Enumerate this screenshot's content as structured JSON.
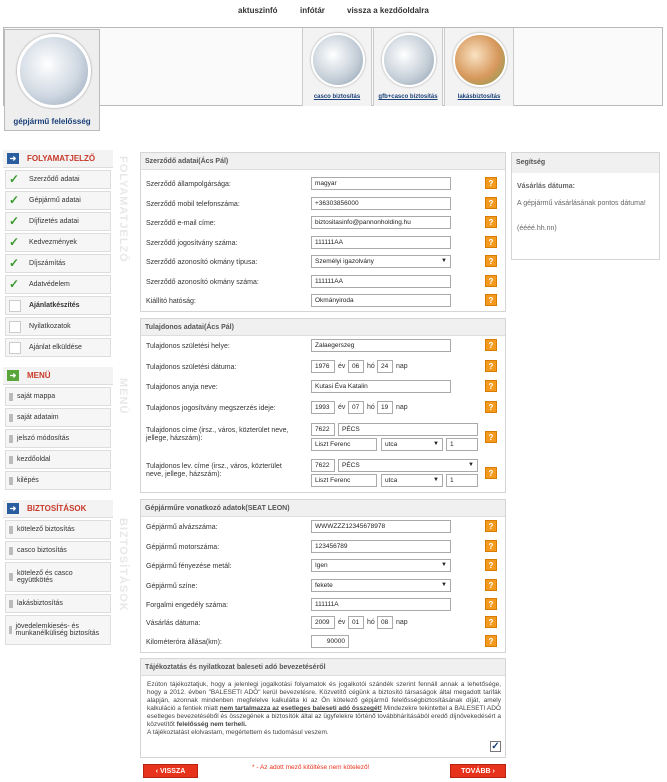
{
  "topnav": [
    "aktuszinfó",
    "infótár",
    "vissza a kezdőoldalra"
  ],
  "brand": "gépjármű felelősség",
  "promos": [
    "casco biztosítás",
    "gfb+casco biztosítás",
    "lakásbiztosítás"
  ],
  "sidebar": {
    "process_title": "FOLYAMATJELZŐ",
    "process": [
      {
        "label": "Szerződő adatai",
        "done": true
      },
      {
        "label": "Gépjármű adatai",
        "done": true
      },
      {
        "label": "Díjfizetés adatai",
        "done": true
      },
      {
        "label": "Kedvezmények",
        "done": true
      },
      {
        "label": "Díjszámítás",
        "done": true
      },
      {
        "label": "Adatvédelem",
        "done": true
      },
      {
        "label": "Ajánlatkészítés",
        "done": false
      },
      {
        "label": "Nyilatkozatok",
        "done": false
      },
      {
        "label": "Ajánlat elküldése",
        "done": false
      }
    ],
    "menu_title": "MENÜ",
    "menu": [
      "saját mappa",
      "saját adataim",
      "jelszó módosítás",
      "kezdőoldal",
      "kilépés"
    ],
    "ins_title": "BIZTOSÍTÁSOK",
    "ins": [
      "kötelező biztosítás",
      "casco biztosítás",
      "kötelező és casco együttkötés",
      "lakásbiztosítás",
      "jövedelemkiesés- és munkanélküliség biztosítás"
    ],
    "vert": [
      "FOLYAMATJELZŐ",
      "MENÜ",
      "BIZTOSÍTÁSOK"
    ]
  },
  "contractor": {
    "title": "Szerződő adatai(Ács Pál)",
    "rows": [
      {
        "label": "Szerződő állampolgársága:",
        "value": "magyar"
      },
      {
        "label": "Szerződő mobil telefonszáma:",
        "value": "+36303856000"
      },
      {
        "label": "Szerződő e-mail címe:",
        "value": "biztositasinfo@pannonholding.hu"
      },
      {
        "label": "Szerződő jogosítvány száma:",
        "value": "111111AA"
      },
      {
        "label": "Szerződő azonosító okmány típusa:",
        "value": "Személyi igazolvány"
      },
      {
        "label": "Szerződő azonosító okmány száma:",
        "value": "111111AA"
      },
      {
        "label": "Kiállító hatóság:",
        "value": "Okmányiroda"
      }
    ]
  },
  "owner": {
    "title": "Tulajdonos adatai(Ács Pál)",
    "birthplace_label": "Tulajdonos születési helye:",
    "birthplace": "Zalaegerszeg",
    "birthdate_label": "Tulajdonos születési dátuma:",
    "birth": [
      "1976",
      "06",
      "24"
    ],
    "mother_label": "Tulajdonos anyja neve:",
    "mother": "Kutasi Éva Katalin",
    "license_label": "Tulajdonos jogosítvány megszerzés ideje:",
    "license": [
      "1993",
      "07",
      "19"
    ],
    "addr_label": "Tulajdonos címe (irsz., város, közterület neve, jellege, házszám):",
    "addr": [
      "7622",
      "PÉCS",
      "Liszt Ferenc",
      "utca",
      "1"
    ],
    "mail_label": "Tulajdonos lev. címe (irsz., város, közterület neve, jellege, házszám):",
    "mail": [
      "7622",
      "PÉCS",
      "Liszt Ferenc",
      "utca",
      "1"
    ],
    "ev": "év",
    "ho": "hó",
    "nap": "nap"
  },
  "vehicle": {
    "title": "Gépjárműre vonatkozó adatok(SEAT LEON)",
    "rows": [
      {
        "label": "Gépjármű alvázszáma:",
        "value": "WWWZZZ12345678978"
      },
      {
        "label": "Gépjármű motorszáma:",
        "value": "123456789"
      },
      {
        "label": "Gépjármű fényezése metál:",
        "value": "Igen"
      },
      {
        "label": "Gépjármű színe:",
        "value": "fekete"
      },
      {
        "label": "Forgalmi engedély száma:",
        "value": "111111A"
      }
    ],
    "purchase_label": "Vásárlás dátuma:",
    "purchase": [
      "2009",
      "01",
      "08"
    ],
    "km_label": "Kilométeróra állása(km):",
    "km": "90000"
  },
  "help": {
    "title": "Segítség",
    "subtitle": "Vásárlás dátuma:",
    "body": "A gépjármű vásárlásának pontos dátuma!",
    "format": "(éééé.hh.nn)"
  },
  "notice": {
    "title": "Tájékoztatás és nyilatkozat baleseti adó bevezetéséről",
    "p1": "Ezúton tájékoztatjuk, hogy a jelenlegi jogalkotási folyamatok és jogalkotói szándék szerint fennáll annak a lehetősége, hogy a 2012. évben \"BALESETI ADÓ\" kerül bevezetésre. Közvetítő cégünk a biztosító társaságok által megadott tarifák alapján, azonnak mindenben megfelelve kalkulálta ki az Ön kötelező gépjármű felelősségbiztosításának díját, amely kalkuláció a fentiek miatt ",
    "p1b": "nem tartalmazza az esetleges baleseti adó összegét!",
    "p2": " Mindezekre tekintettel a BALESETI ADÓ esetleges bevezetéséből és összegének a biztosítók által az ügyfelekre történő továbbhárításából eredő díjnövekedésért a közvetítőt ",
    "p2b": "felelősség nem terheli.",
    "p3": "A tájékoztatást elolvastam, megértettem és tudomásul veszem."
  },
  "buttons": {
    "back": "‹ VISSZA",
    "next": "TOVÁBB ›"
  },
  "required_note": "* - Az adott mező kitöltése nem kötelező!"
}
